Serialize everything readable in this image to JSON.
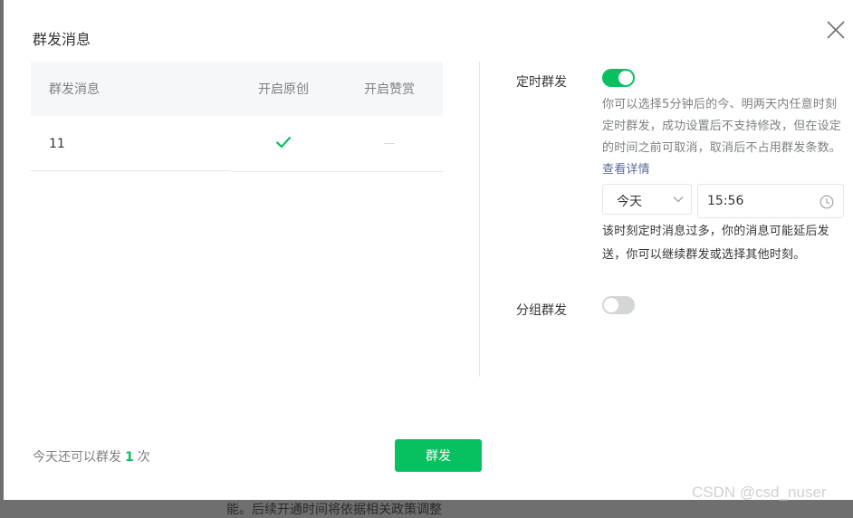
{
  "backdrop": {
    "partial_text": "能。后续开通时间将依据相关政策调整"
  },
  "dialog": {
    "title": "群发消息",
    "close_icon": "close-icon",
    "table": {
      "headers": [
        "群发消息",
        "开启原创",
        "开启赞赏"
      ],
      "rows": [
        {
          "message": "11",
          "original": "check-icon",
          "reward": "dash"
        }
      ]
    },
    "scheduled": {
      "label": "定时群发",
      "enabled": true,
      "description": "你可以选择5分钟后的今、明两天内任意时刻定时群发，成功设置后不支持修改，但在设定的时间之前可取消，取消后不占用群发条数。",
      "link": "查看详情",
      "day_value": "今天",
      "time_value": "15:56",
      "warning": "该时刻定时消息过多，你的消息可能延后发送，你可以继续群发或选择其他时刻。"
    },
    "group": {
      "label": "分组群发",
      "enabled": false
    },
    "footer": {
      "count_prefix": "今天还可以群发",
      "count_value": "1",
      "count_suffix": "次",
      "send_button": "群发"
    }
  },
  "watermark": "CSDN @csd_nuser",
  "colors": {
    "accent": "#07c160",
    "link": "#576b95",
    "header_bg": "#f6f7f9",
    "border": "#e7e7eb"
  }
}
